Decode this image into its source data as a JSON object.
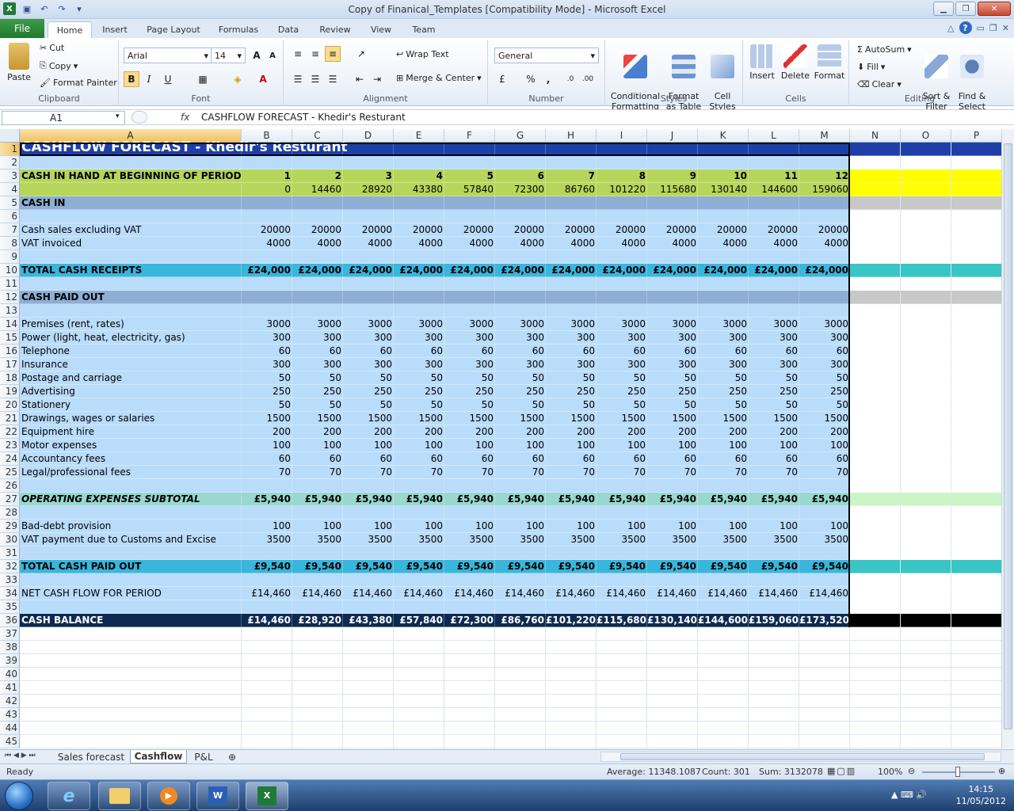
{
  "window": {
    "title": "Copy of Finanical_Templates  [Compatibility Mode]  -  Microsoft Excel"
  },
  "ribbon_tabs": [
    "File",
    "Home",
    "Insert",
    "Page Layout",
    "Formulas",
    "Data",
    "Review",
    "View",
    "Team"
  ],
  "ribbon": {
    "clipboard": {
      "label": "Clipboard",
      "paste": "Paste",
      "cut": "Cut",
      "copy": "Copy",
      "format_painter": "Format Painter"
    },
    "font": {
      "label": "Font",
      "name": "Arial",
      "size": "14",
      "bold": "B",
      "italic": "I",
      "underline": "U",
      "grow": "A",
      "shrink": "A"
    },
    "alignment": {
      "label": "Alignment",
      "wrap": "Wrap Text",
      "merge": "Merge & Center"
    },
    "number": {
      "label": "Number",
      "format": "General",
      "percent": "%",
      "comma": ","
    },
    "styles": {
      "label": "Styles",
      "conditional": "Conditional\nFormatting",
      "format_table": "Format\nas Table",
      "cell_styles": "Cell\nStyles"
    },
    "cells": {
      "label": "Cells",
      "insert": "Insert",
      "delete": "Delete",
      "format": "Format"
    },
    "editing": {
      "label": "Editing",
      "autosum": "AutoSum",
      "fill": "Fill",
      "clear": "Clear",
      "sort": "Sort &\nFilter",
      "find": "Find &\nSelect"
    }
  },
  "formula_bar": {
    "name_box": "A1",
    "fx": "fx",
    "content": "CASHFLOW FORECAST  - Khedir's Resturant"
  },
  "columns": [
    "A",
    "B",
    "C",
    "D",
    "E",
    "F",
    "G",
    "H",
    "I",
    "J",
    "K",
    "L",
    "M",
    "N",
    "O",
    "P"
  ],
  "rows": {
    "r1": {
      "num": "1",
      "label": "CASHFLOW FORECAST  - Khedir's Resturant"
    },
    "r3": {
      "num": "3",
      "label": "CASH IN HAND AT BEGINNING OF PERIOD",
      "values": [
        "1",
        "2",
        "3",
        "4",
        "5",
        "6",
        "7",
        "8",
        "9",
        "10",
        "11",
        "12"
      ]
    },
    "r4": {
      "num": "4",
      "values": [
        "0",
        "14460",
        "28920",
        "43380",
        "57840",
        "72300",
        "86760",
        "101220",
        "115680",
        "130140",
        "144600",
        "159060"
      ]
    },
    "r5": {
      "num": "5",
      "label": "CASH IN"
    },
    "r7": {
      "num": "7",
      "label": "Cash sales excluding VAT",
      "values": [
        "20000",
        "20000",
        "20000",
        "20000",
        "20000",
        "20000",
        "20000",
        "20000",
        "20000",
        "20000",
        "20000",
        "20000"
      ]
    },
    "r8": {
      "num": "8",
      "label": "VAT invoiced",
      "values": [
        "4000",
        "4000",
        "4000",
        "4000",
        "4000",
        "4000",
        "4000",
        "4000",
        "4000",
        "4000",
        "4000",
        "4000"
      ]
    },
    "r10": {
      "num": "10",
      "label": "TOTAL CASH RECEIPTS",
      "values": [
        "£24,000",
        "£24,000",
        "£24,000",
        "£24,000",
        "£24,000",
        "£24,000",
        "£24,000",
        "£24,000",
        "£24,000",
        "£24,000",
        "£24,000",
        "£24,000"
      ]
    },
    "r12": {
      "num": "12",
      "label": "CASH PAID OUT"
    },
    "r14": {
      "num": "14",
      "label": "Premises (rent, rates)",
      "values": [
        "3000",
        "3000",
        "3000",
        "3000",
        "3000",
        "3000",
        "3000",
        "3000",
        "3000",
        "3000",
        "3000",
        "3000"
      ]
    },
    "r15": {
      "num": "15",
      "label": "Power (light, heat, electricity, gas)",
      "values": [
        "300",
        "300",
        "300",
        "300",
        "300",
        "300",
        "300",
        "300",
        "300",
        "300",
        "300",
        "300"
      ]
    },
    "r16": {
      "num": "16",
      "label": "Telephone",
      "values": [
        "60",
        "60",
        "60",
        "60",
        "60",
        "60",
        "60",
        "60",
        "60",
        "60",
        "60",
        "60"
      ]
    },
    "r17": {
      "num": "17",
      "label": "Insurance",
      "values": [
        "300",
        "300",
        "300",
        "300",
        "300",
        "300",
        "300",
        "300",
        "300",
        "300",
        "300",
        "300"
      ]
    },
    "r18": {
      "num": "18",
      "label": "Postage and carriage",
      "values": [
        "50",
        "50",
        "50",
        "50",
        "50",
        "50",
        "50",
        "50",
        "50",
        "50",
        "50",
        "50"
      ]
    },
    "r19": {
      "num": "19",
      "label": "Advertising",
      "values": [
        "250",
        "250",
        "250",
        "250",
        "250",
        "250",
        "250",
        "250",
        "250",
        "250",
        "250",
        "250"
      ]
    },
    "r20": {
      "num": "20",
      "label": "Stationery",
      "values": [
        "50",
        "50",
        "50",
        "50",
        "50",
        "50",
        "50",
        "50",
        "50",
        "50",
        "50",
        "50"
      ]
    },
    "r21": {
      "num": "21",
      "label": "Drawings, wages or salaries",
      "values": [
        "1500",
        "1500",
        "1500",
        "1500",
        "1500",
        "1500",
        "1500",
        "1500",
        "1500",
        "1500",
        "1500",
        "1500"
      ]
    },
    "r22": {
      "num": "22",
      "label": "Equipment hire",
      "values": [
        "200",
        "200",
        "200",
        "200",
        "200",
        "200",
        "200",
        "200",
        "200",
        "200",
        "200",
        "200"
      ]
    },
    "r23": {
      "num": "23",
      "label": "Motor expenses",
      "values": [
        "100",
        "100",
        "100",
        "100",
        "100",
        "100",
        "100",
        "100",
        "100",
        "100",
        "100",
        "100"
      ]
    },
    "r24": {
      "num": "24",
      "label": "Accountancy fees",
      "values": [
        "60",
        "60",
        "60",
        "60",
        "60",
        "60",
        "60",
        "60",
        "60",
        "60",
        "60",
        "60"
      ]
    },
    "r25": {
      "num": "25",
      "label": "Legal/professional fees",
      "values": [
        "70",
        "70",
        "70",
        "70",
        "70",
        "70",
        "70",
        "70",
        "70",
        "70",
        "70",
        "70"
      ]
    },
    "r27": {
      "num": "27",
      "label": "OPERATING EXPENSES SUBTOTAL",
      "values": [
        "£5,940",
        "£5,940",
        "£5,940",
        "£5,940",
        "£5,940",
        "£5,940",
        "£5,940",
        "£5,940",
        "£5,940",
        "£5,940",
        "£5,940",
        "£5,940"
      ]
    },
    "r29": {
      "num": "29",
      "label": "Bad-debt provision",
      "values": [
        "100",
        "100",
        "100",
        "100",
        "100",
        "100",
        "100",
        "100",
        "100",
        "100",
        "100",
        "100"
      ]
    },
    "r30": {
      "num": "30",
      "label": "VAT payment due to Customs and Excise",
      "values": [
        "3500",
        "3500",
        "3500",
        "3500",
        "3500",
        "3500",
        "3500",
        "3500",
        "3500",
        "3500",
        "3500",
        "3500"
      ]
    },
    "r32": {
      "num": "32",
      "label": "TOTAL CASH PAID OUT",
      "values": [
        "£9,540",
        "£9,540",
        "£9,540",
        "£9,540",
        "£9,540",
        "£9,540",
        "£9,540",
        "£9,540",
        "£9,540",
        "£9,540",
        "£9,540",
        "£9,540"
      ]
    },
    "r34": {
      "num": "34",
      "label": "NET CASH FLOW FOR PERIOD",
      "values": [
        "£14,460",
        "£14,460",
        "£14,460",
        "£14,460",
        "£14,460",
        "£14,460",
        "£14,460",
        "£14,460",
        "£14,460",
        "£14,460",
        "£14,460",
        "£14,460"
      ]
    },
    "r36": {
      "num": "36",
      "label": "CASH BALANCE",
      "values": [
        "£14,460",
        "£28,920",
        "£43,380",
        "£57,840",
        "£72,300",
        "£86,760",
        "£101,220",
        "£115,680",
        "£130,140",
        "£144,600",
        "£159,060",
        "£173,520"
      ]
    }
  },
  "empty_row_numbers": [
    "2",
    "6",
    "9",
    "11",
    "13",
    "26",
    "28",
    "31",
    "33",
    "35",
    "37",
    "38",
    "39",
    "40",
    "41",
    "42",
    "43",
    "44",
    "45"
  ],
  "sheet_tabs": [
    "Sales forecast",
    "Cashflow",
    "P&L"
  ],
  "status_bar": {
    "ready": "Ready",
    "average": "Average: 11348.1087",
    "count": "Count: 301",
    "sum": "Sum: 3132078",
    "zoom": "100%"
  },
  "taskbar": {
    "time": "14:15",
    "date": "11/05/2012"
  },
  "colors": {
    "title_bg": "#1e3ea8",
    "light_blue": "#b9dcfa",
    "green": "#b5d65a",
    "section": "#8eaed4",
    "cyan": "#39b6dc",
    "teal": "#98d8d0",
    "navy": "#0e2a52",
    "yellow": "#ffff00"
  }
}
